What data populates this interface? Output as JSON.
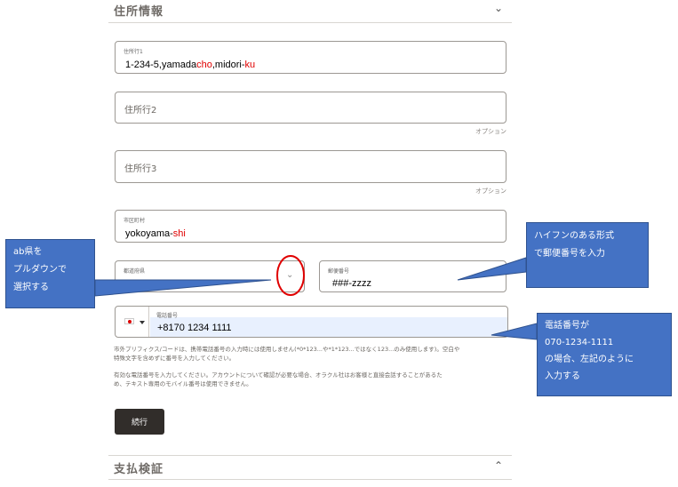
{
  "address_section": {
    "title": "住所情報",
    "chevron": "chevron-down-icon"
  },
  "fields": {
    "address1": {
      "label": "住所行1",
      "value_parts": [
        "1-234-5,yamada",
        "cho",
        ",midori-",
        "ku"
      ]
    },
    "address2": {
      "placeholder": "住所行2",
      "optional": "オプション"
    },
    "address3": {
      "placeholder": "住所行3",
      "optional": "オプション"
    },
    "city": {
      "label": "市区町村",
      "value_parts": [
        "yokoyama-",
        "shi"
      ]
    },
    "prefecture": {
      "label": "都道府県",
      "value": ""
    },
    "postal": {
      "label": "郵便番号",
      "value": "###-zzzz"
    },
    "phone": {
      "label": "電話番号",
      "country_flag": "japan-flag-icon",
      "value": "+8170  1234 1111"
    }
  },
  "help_text": {
    "line1": "市外プリフィクス/コードは、携帯電話番号の入力時には使用しません(*0*123...や*1*123...ではなく123...のみ使用します)。空白や",
    "line2": "特殊文字を含めずに番号を入力してください。",
    "line3": "有効な電話番号を入力してください。アカウントについて確認が必要な場合、オラクル社はお客様と直接会話することがあるた",
    "line4": "め、テキスト専用のモバイル番号は使用できません。"
  },
  "continue_button": {
    "label": "続行"
  },
  "payment_section": {
    "title": "支払検証",
    "chevron": "chevron-up-icon"
  },
  "callouts": {
    "prefecture": {
      "line1": "ab県を",
      "line2": "プルダウンで",
      "line3": "選択する"
    },
    "postal": {
      "line1": "ハイフンのある形式",
      "line2": "で郵便番号を入力"
    },
    "phone": {
      "line1": "電話番号が",
      "line2": "070-1234-1111",
      "line3": "の場合、左記のように",
      "line4": "入力する"
    }
  },
  "colors": {
    "callout_fill": "#4472c4",
    "highlight_red": "#e00000",
    "button_bg": "#312d2a"
  }
}
